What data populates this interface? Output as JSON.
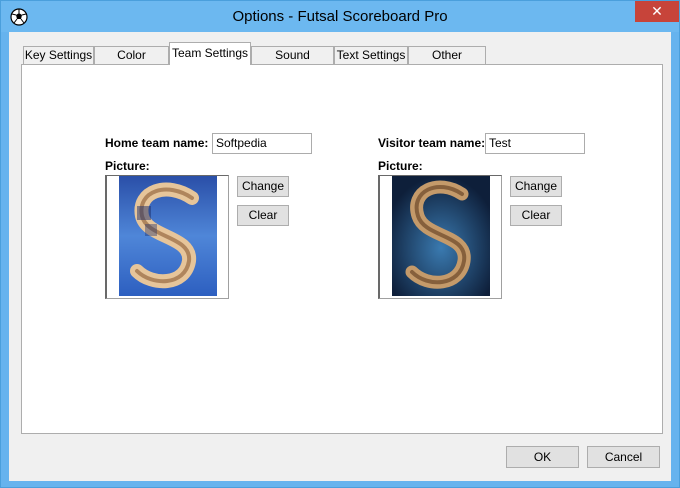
{
  "window": {
    "title": "Options - Futsal Scoreboard Pro",
    "app_icon": "soccer-ball-icon",
    "close_icon": "close-icon",
    "close_glyph": "✕",
    "titlebar_color": "#6cb8f0",
    "close_color": "#c7443a"
  },
  "tabs": [
    {
      "label": "Key Settings",
      "active": false
    },
    {
      "label": "Color Settings",
      "active": false
    },
    {
      "label": "Team Settings",
      "active": true
    },
    {
      "label": "Sound Settings",
      "active": false
    },
    {
      "label": "Text Settings",
      "active": false
    },
    {
      "label": "Other Settings",
      "active": false
    }
  ],
  "home": {
    "name_label": "Home team name:",
    "name_value": "Softpedia",
    "picture_label": "Picture:",
    "change_label": "Change",
    "clear_label": "Clear"
  },
  "visitor": {
    "name_label": "Visitor team name:",
    "name_value": "Test",
    "picture_label": "Picture:",
    "change_label": "Change",
    "clear_label": "Clear"
  },
  "footer": {
    "ok_label": "OK",
    "cancel_label": "Cancel"
  }
}
